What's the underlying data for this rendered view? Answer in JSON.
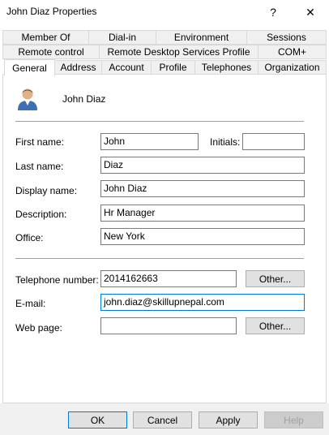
{
  "window": {
    "title": "John Diaz Properties",
    "help_glyph": "?",
    "close_glyph": "✕"
  },
  "tabs": {
    "row1": [
      "Member Of",
      "Dial-in",
      "Environment",
      "Sessions"
    ],
    "row2": [
      "Remote control",
      "Remote Desktop Services Profile",
      "COM+"
    ],
    "row3": [
      "General",
      "Address",
      "Account",
      "Profile",
      "Telephones",
      "Organization"
    ],
    "active": "General"
  },
  "header": {
    "user_name": "John Diaz",
    "icon": "user-icon"
  },
  "form": {
    "first_name_label": "First name:",
    "first_name": "John",
    "initials_label": "Initials:",
    "initials": "",
    "last_name_label": "Last name:",
    "last_name": "Diaz",
    "display_name_label": "Display name:",
    "display_name": "John Diaz",
    "description_label": "Description:",
    "description": "Hr Manager",
    "office_label": "Office:",
    "office": "New York",
    "telephone_label": "Telephone number:",
    "telephone": "2014162663",
    "email_label": "E-mail:",
    "email": "john.diaz@skillupnepal.com",
    "webpage_label": "Web page:",
    "webpage": "",
    "other_label": "Other..."
  },
  "buttons": {
    "ok": "OK",
    "cancel": "Cancel",
    "apply": "Apply",
    "help": "Help"
  }
}
